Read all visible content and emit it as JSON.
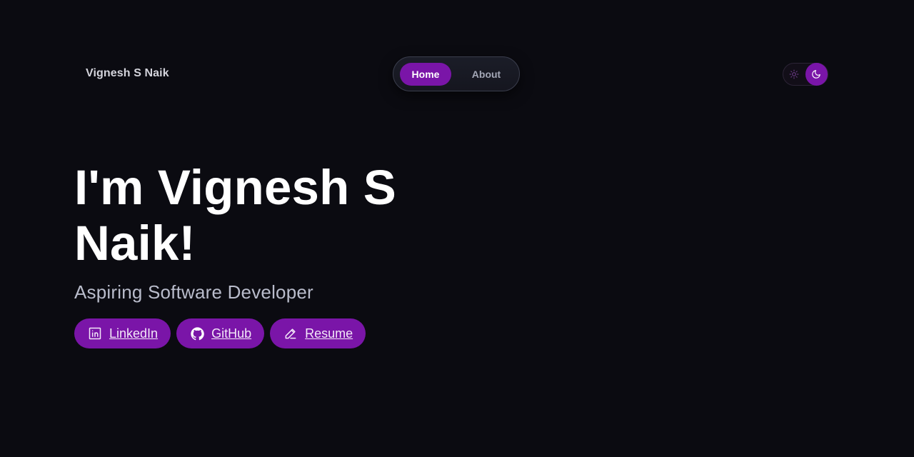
{
  "header": {
    "brand": "Vignesh S Naik",
    "nav": [
      {
        "label": "Home",
        "active": true
      },
      {
        "label": "About",
        "active": false
      }
    ],
    "theme_toggle": {
      "options": [
        "sun-icon",
        "moon-icon"
      ],
      "selected": "moon-icon"
    }
  },
  "hero": {
    "title": "I'm Vignesh S Naik!",
    "subtitle": "Aspiring Software Developer",
    "links": [
      {
        "label": "LinkedIn",
        "icon": "linkedin-icon"
      },
      {
        "label": "GitHub",
        "icon": "github-icon"
      },
      {
        "label": "Resume",
        "icon": "pencil-icon"
      }
    ]
  },
  "colors": {
    "background": "#0b0b11",
    "accent": "#7a15a8",
    "text_primary": "#ffffff",
    "text_secondary": "#b9bccb"
  }
}
